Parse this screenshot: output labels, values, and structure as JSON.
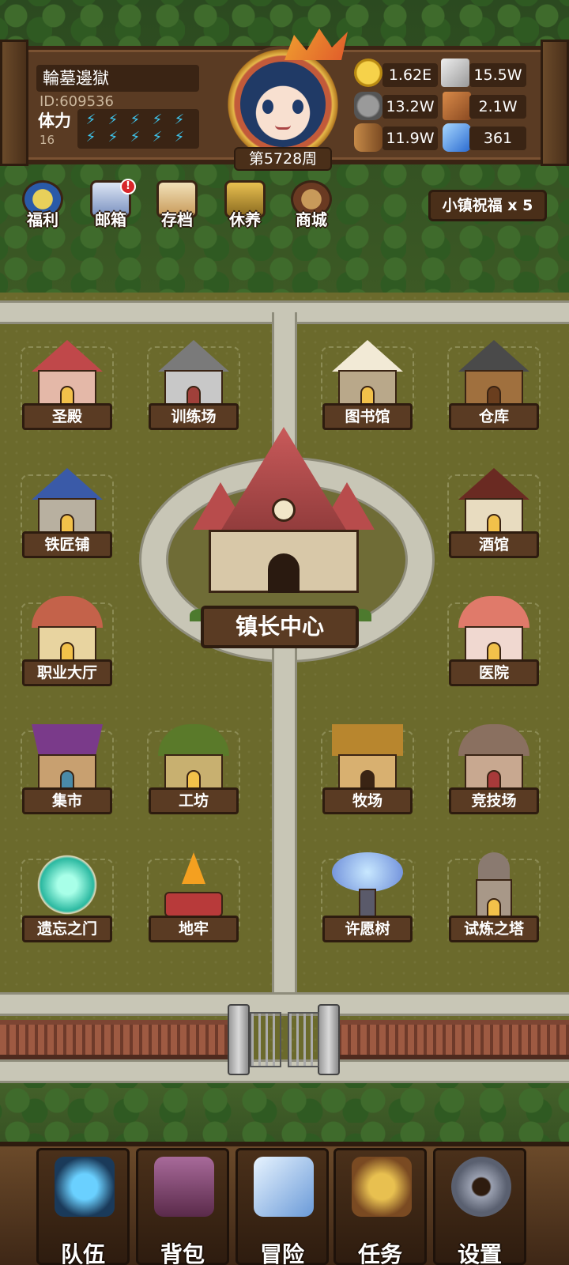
{
  "player": {
    "name": "輪墓邊獄",
    "id_text": "ID:609536",
    "stamina_label": "体力",
    "stamina_value": "16",
    "stamina_bolts": 10,
    "week_label": "第5728周"
  },
  "resources": {
    "gold": "1.62E",
    "iron": "15.5W",
    "stone": "13.2W",
    "leather": "2.1W",
    "wood": "11.9W",
    "crystal": "361"
  },
  "top_menu": {
    "welfare": "福利",
    "mailbox": "邮箱",
    "save": "存档",
    "rest": "休养",
    "shop": "商城",
    "mail_badge": "!",
    "blessing": "小镇祝福 x 5"
  },
  "buildings": {
    "temple": "圣殿",
    "training": "训练场",
    "library": "图书馆",
    "warehouse": "仓库",
    "blacksmith": "铁匠铺",
    "tavern": "酒馆",
    "town_hall": "镇长中心",
    "job_hall": "职业大厅",
    "hospital": "医院",
    "market": "集市",
    "workshop": "工坊",
    "ranch": "牧场",
    "arena": "竞技场",
    "oblivion_gate": "遗忘之门",
    "dungeon": "地牢",
    "wishing_tree": "许愿树",
    "trial_tower": "试炼之塔"
  },
  "bottom_nav": {
    "team": "队伍",
    "bag": "背包",
    "adventure": "冒险",
    "quest": "任务",
    "settings": "设置"
  },
  "icons": {
    "bolt": "⚡"
  }
}
